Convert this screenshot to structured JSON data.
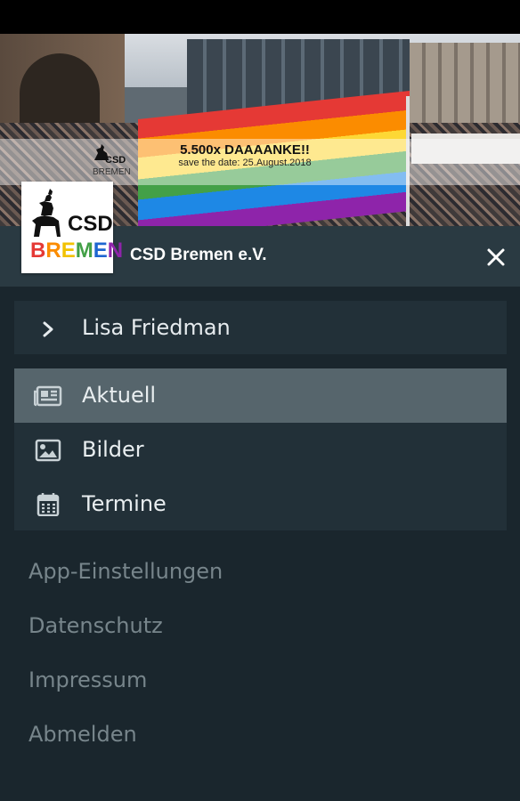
{
  "banner": {
    "promo_title": "5.500x DAAAANKE!!",
    "promo_subtitle": "save the date: 25.August.2018",
    "mini_logo_line1": "CSD",
    "mini_logo_line2": "BREMEN"
  },
  "header": {
    "logo_csd": "CSD",
    "logo_bremen_letters": [
      "B",
      "R",
      "E",
      "M",
      "E",
      "N"
    ],
    "logo_bremen_colors": [
      "#e53935",
      "#fb8c00",
      "#f2c200",
      "#43a047",
      "#1e66d0",
      "#8e24aa"
    ],
    "org_name": "CSD Bremen e.V.",
    "close_icon": "close-icon"
  },
  "user": {
    "name": "Lisa Friedman",
    "icon": "chevron-right-icon"
  },
  "menu": {
    "items": [
      {
        "label": "Aktuell",
        "icon": "newspaper-icon",
        "active": true
      },
      {
        "label": "Bilder",
        "icon": "image-icon",
        "active": false
      },
      {
        "label": "Termine",
        "icon": "calendar-icon",
        "active": false
      }
    ]
  },
  "links": {
    "settings": "App-Einstellungen",
    "privacy": "Datenschutz",
    "imprint": "Impressum",
    "logout": "Abmelden"
  },
  "colors": {
    "background": "#1a262d",
    "header": "#2a3a42",
    "card": "#223038",
    "active_item": "#56656c",
    "muted_link": "#77858b"
  }
}
